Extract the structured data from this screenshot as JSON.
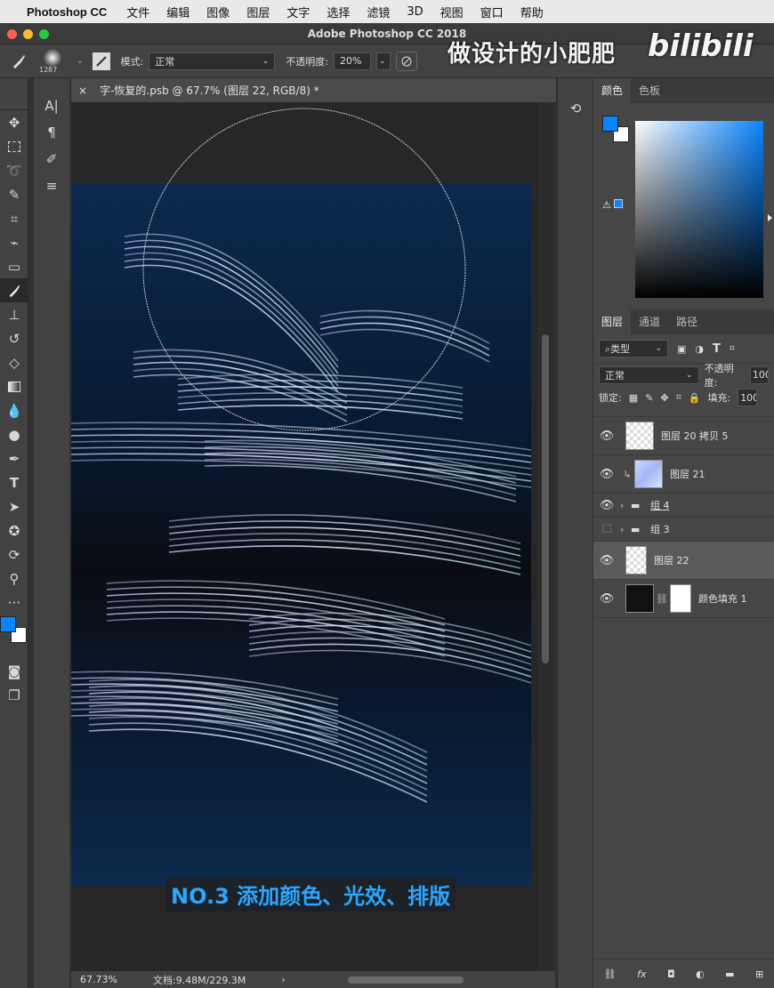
{
  "menu": {
    "app": "Photoshop CC",
    "items": [
      "文件",
      "编辑",
      "图像",
      "图层",
      "文字",
      "选择",
      "滤镜",
      "3D",
      "视图",
      "窗口",
      "帮助"
    ]
  },
  "window_title": "Adobe Photoshop CC 2018",
  "watermark": {
    "text": "做设计的小肥肥",
    "logo": "bilibili"
  },
  "options": {
    "brush_size": "1287",
    "mode_label": "模式:",
    "mode_value": "正常",
    "opacity_label": "不透明度:",
    "opacity_value": "20%"
  },
  "document": {
    "tab": "字-恢复的.psb @ 67.7% (图层 22, RGB/8) *",
    "close": "×"
  },
  "caption": "NO.3 添加颜色、光效、排版",
  "status": {
    "zoom": "67.73%",
    "doc": "文档:9.48M/229.3M",
    "arrow": "›"
  },
  "color_panel": {
    "tabs": [
      "颜色",
      "色板"
    ],
    "fg": "#0a84ff",
    "bg": "#ffffff"
  },
  "layers_panel": {
    "tabs": [
      "图层",
      "通道",
      "路径"
    ],
    "filter": "类型",
    "blend": "正常",
    "opacity_label": "不透明度:",
    "opacity_value": "100",
    "lock_label": "锁定:",
    "fill_label": "填充:",
    "fill_value": "100",
    "layers": [
      {
        "name": "图层 20 拷贝 5"
      },
      {
        "name": "图层 21"
      },
      {
        "name": "组 4"
      },
      {
        "name": "组 3"
      },
      {
        "name": "图层 22"
      },
      {
        "name": "颜色填充 1"
      }
    ]
  },
  "colors": {
    "accent": "#2ba6ff",
    "fg_swatch": "#0a84ff"
  }
}
